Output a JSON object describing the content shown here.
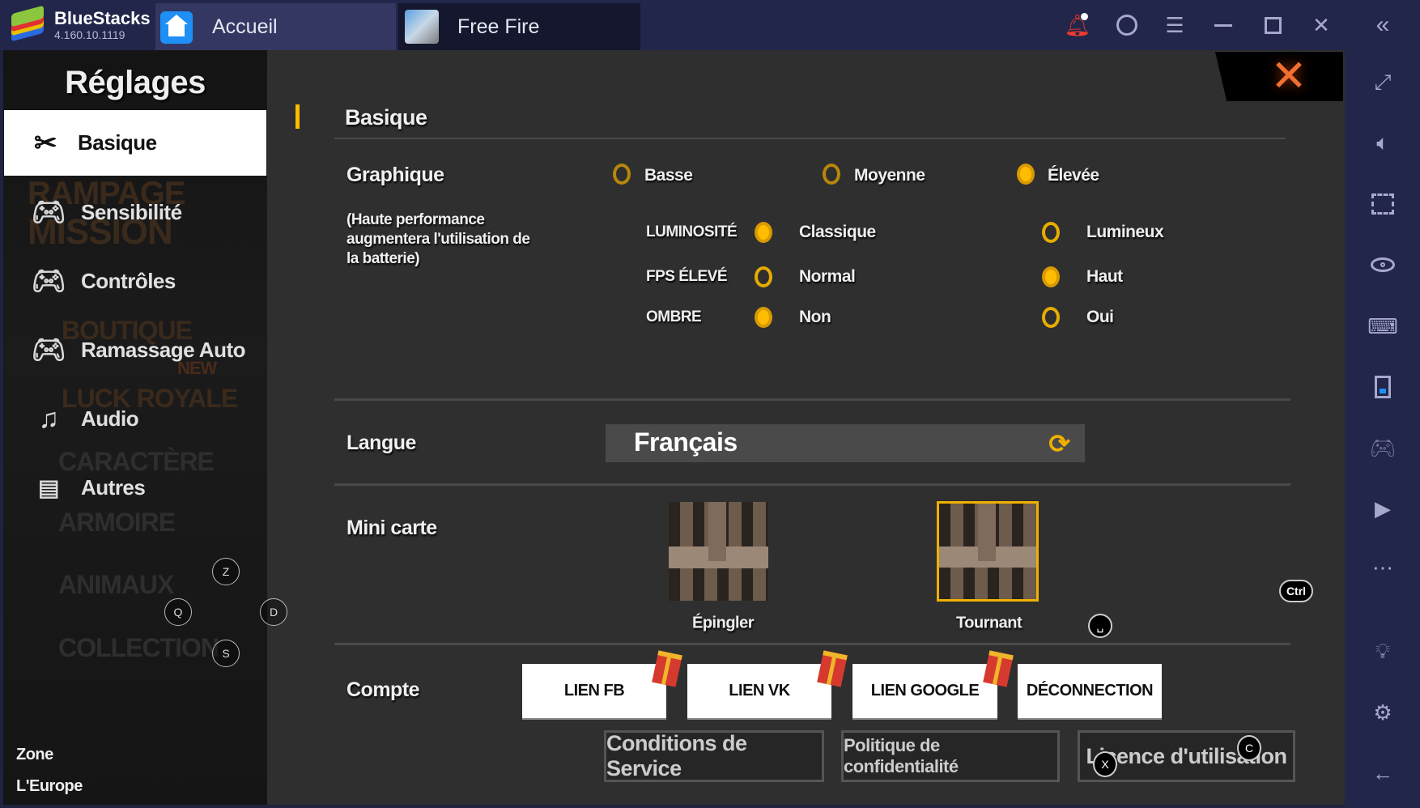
{
  "app": {
    "name": "BlueStacks",
    "version": "4.160.10.1119"
  },
  "tabs": [
    {
      "label": "Accueil",
      "icon": "home-icon"
    },
    {
      "label": "Free Fire",
      "icon": "free-fire-app-icon"
    }
  ],
  "topbar_icons": [
    "bell-icon",
    "account-icon",
    "menu-icon",
    "minimize-icon",
    "maximize-icon",
    "close-icon",
    "collapse-sidebar-icon"
  ],
  "right_toolbar": [
    "fullscreen-icon",
    "volume-icon",
    "screenshot-pointer-icon",
    "eye-icon",
    "keyboard-icon",
    "screen-record-icon",
    "gamepad-icon",
    "media-folder-icon",
    "more-icon",
    "brightness-icon",
    "settings-icon",
    "back-icon"
  ],
  "colors": {
    "accent": "#ffbc00",
    "close": "#f07030",
    "topbar": "#22264a",
    "panel": "#2f2f2f"
  },
  "sidebar": {
    "title": "Réglages",
    "items": [
      {
        "label": "Basique",
        "icon": "tools-icon",
        "selected": true
      },
      {
        "label": "Sensibilité",
        "icon": "gamepad-icon"
      },
      {
        "label": "Contrôles",
        "icon": "gamepad-icon"
      },
      {
        "label": "Ramassage Auto",
        "icon": "gamepad-icon"
      },
      {
        "label": "Audio",
        "icon": "music-note-icon"
      },
      {
        "label": "Autres",
        "icon": "document-icon"
      }
    ],
    "background_labels": [
      "RAMPAGE",
      "MISSION",
      "BOUTIQUE",
      "NEW",
      "LUCK ROYALE",
      "CARACTÈRE",
      "ARMOIRE",
      "ANIMAUX",
      "COLLECTION"
    ],
    "zone_label": "Zone",
    "zone_value": "L'Europe"
  },
  "keys": {
    "up": "Z",
    "left": "Q",
    "right": "D",
    "down": "S",
    "ctrl": "Ctrl",
    "space": "␣",
    "c": "C",
    "x": "X"
  },
  "main": {
    "section_title": "Basique",
    "graphics": {
      "label": "Graphique",
      "note": "(Haute performance augmentera l'utilisation de la batterie)",
      "options": [
        {
          "label": "Basse",
          "selected": false
        },
        {
          "label": "Moyenne",
          "selected": false
        },
        {
          "label": "Élevée",
          "selected": true
        }
      ],
      "rows": [
        {
          "label": "LUMINOSITÉ",
          "options": [
            {
              "label": "Classique",
              "selected": true
            },
            {
              "label": "Lumineux",
              "selected": false
            }
          ]
        },
        {
          "label": "FPS ÉLEVÉ",
          "options": [
            {
              "label": "Normal",
              "selected": false
            },
            {
              "label": "Haut",
              "selected": true
            }
          ]
        },
        {
          "label": "OMBRE",
          "options": [
            {
              "label": "Non",
              "selected": true
            },
            {
              "label": "Oui",
              "selected": false
            }
          ]
        }
      ]
    },
    "language": {
      "label": "Langue",
      "value": "Français"
    },
    "minimap": {
      "label": "Mini carte",
      "options": [
        {
          "label": "Épingler",
          "selected": false
        },
        {
          "label": "Tournant",
          "selected": true
        }
      ]
    },
    "account": {
      "label": "Compte",
      "buttons": [
        "LIEN FB",
        "LIEN VK",
        "LIEN GOOGLE",
        "DÉCONNECTION"
      ],
      "links": [
        "Conditions de Service",
        "Politique de confidentialité",
        "Licence d'utilisation"
      ]
    }
  }
}
